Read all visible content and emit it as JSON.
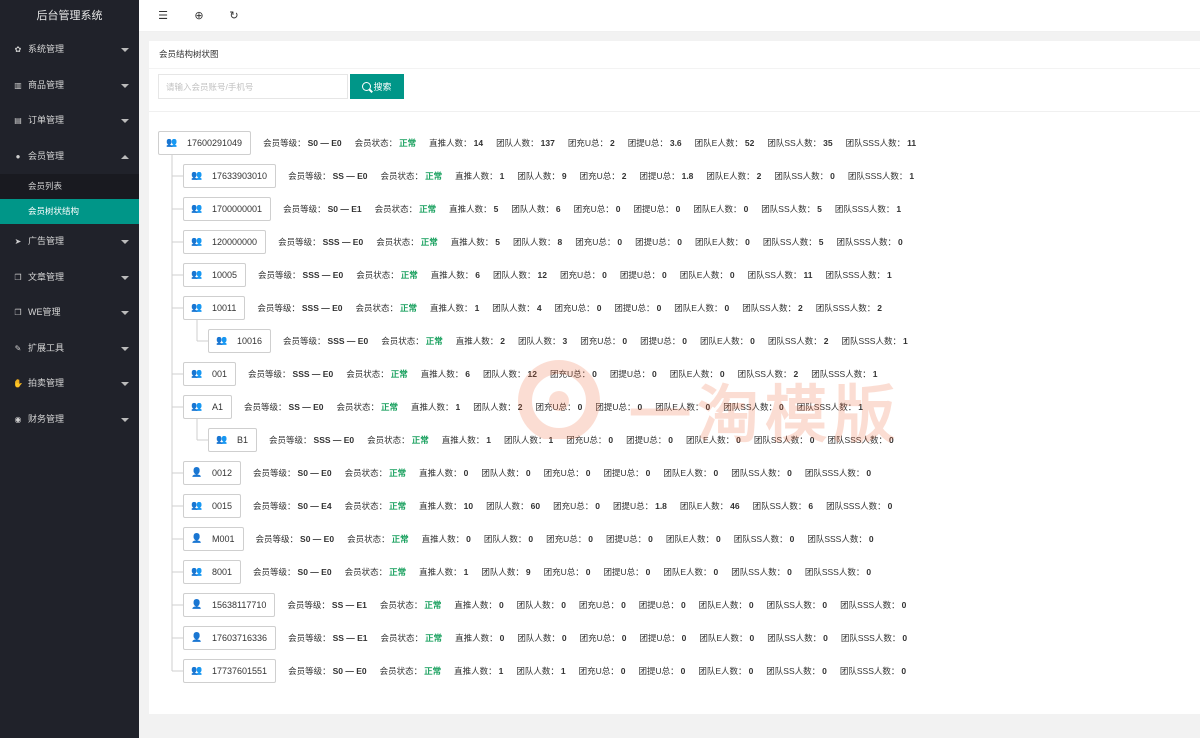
{
  "app": {
    "title": "后台管理系统"
  },
  "sidebar": {
    "items": [
      {
        "label": "系统管理",
        "icon": "gear-icon",
        "glyph": "✿",
        "expanded": false
      },
      {
        "label": "商品管理",
        "icon": "bar-chart-icon",
        "glyph": "▥",
        "expanded": false
      },
      {
        "label": "订单管理",
        "icon": "list-icon",
        "glyph": "▤",
        "expanded": false
      },
      {
        "label": "会员管理",
        "icon": "users-icon",
        "glyph": "●",
        "expanded": true,
        "children": [
          {
            "label": "会员列表",
            "active": false
          },
          {
            "label": "会员树状结构",
            "active": true
          }
        ]
      },
      {
        "label": "广告管理",
        "icon": "rocket-icon",
        "glyph": "➤",
        "expanded": false
      },
      {
        "label": "文章管理",
        "icon": "copy-icon",
        "glyph": "❐",
        "expanded": false
      },
      {
        "label": "WE管理",
        "icon": "copy-icon",
        "glyph": "❐",
        "expanded": false
      },
      {
        "label": "扩展工具",
        "icon": "wrench-icon",
        "glyph": "✎",
        "expanded": false
      },
      {
        "label": "拍卖管理",
        "icon": "hand-icon",
        "glyph": "✋",
        "expanded": false
      },
      {
        "label": "财务管理",
        "icon": "dashboard-icon",
        "glyph": "◉",
        "expanded": false
      }
    ]
  },
  "header": {
    "buttons": [
      {
        "name": "menu-toggle-icon",
        "glyph": "☰"
      },
      {
        "name": "globe-icon",
        "glyph": "⊕"
      },
      {
        "name": "refresh-icon",
        "glyph": "↻"
      }
    ]
  },
  "card": {
    "title": "会员结构树状图"
  },
  "search": {
    "placeholder": "请输入会员账号/手机号",
    "button_label": "搜索"
  },
  "labels": {
    "level": "会员等级：",
    "status": "会员状态：",
    "direct": "直推人数：",
    "team": "团队人数：",
    "recharge": "团充U总：",
    "withdraw": "团提U总：",
    "team_e": "团队E人数：",
    "team_ss": "团队SS人数：",
    "team_sss": "团队SSS人数："
  },
  "tree": [
    {
      "id": "17600291049",
      "depth": 0,
      "group": true,
      "level": "S0 — E0",
      "status": "正常",
      "direct": "14",
      "team": "137",
      "recharge": "2",
      "withdraw": "3.6",
      "team_e": "52",
      "team_ss": "35",
      "team_sss": "11"
    },
    {
      "id": "17633903010",
      "depth": 1,
      "group": true,
      "level": "SS — E0",
      "status": "正常",
      "direct": "1",
      "team": "9",
      "recharge": "2",
      "withdraw": "1.8",
      "team_e": "2",
      "team_ss": "0",
      "team_sss": "1"
    },
    {
      "id": "1700000001",
      "depth": 1,
      "group": true,
      "level": "S0 — E1",
      "status": "正常",
      "direct": "5",
      "team": "6",
      "recharge": "0",
      "withdraw": "0",
      "team_e": "0",
      "team_ss": "5",
      "team_sss": "1"
    },
    {
      "id": "120000000",
      "depth": 1,
      "group": true,
      "level": "SSS — E0",
      "status": "正常",
      "direct": "5",
      "team": "8",
      "recharge": "0",
      "withdraw": "0",
      "team_e": "0",
      "team_ss": "5",
      "team_sss": "0"
    },
    {
      "id": "10005",
      "depth": 1,
      "group": true,
      "level": "SSS — E0",
      "status": "正常",
      "direct": "6",
      "team": "12",
      "recharge": "0",
      "withdraw": "0",
      "team_e": "0",
      "team_ss": "11",
      "team_sss": "1"
    },
    {
      "id": "10011",
      "depth": 1,
      "group": true,
      "level": "SSS — E0",
      "status": "正常",
      "direct": "1",
      "team": "4",
      "recharge": "0",
      "withdraw": "0",
      "team_e": "0",
      "team_ss": "2",
      "team_sss": "2"
    },
    {
      "id": "10016",
      "depth": 2,
      "group": true,
      "level": "SSS — E0",
      "status": "正常",
      "direct": "2",
      "team": "3",
      "recharge": "0",
      "withdraw": "0",
      "team_e": "0",
      "team_ss": "2",
      "team_sss": "1"
    },
    {
      "id": "001",
      "depth": 1,
      "group": true,
      "level": "SSS — E0",
      "status": "正常",
      "direct": "6",
      "team": "12",
      "recharge": "0",
      "withdraw": "0",
      "team_e": "0",
      "team_ss": "2",
      "team_sss": "1"
    },
    {
      "id": "A1",
      "depth": 1,
      "group": true,
      "level": "SS — E0",
      "status": "正常",
      "direct": "1",
      "team": "2",
      "recharge": "0",
      "withdraw": "0",
      "team_e": "0",
      "team_ss": "0",
      "team_sss": "1"
    },
    {
      "id": "B1",
      "depth": 2,
      "group": true,
      "level": "SSS — E0",
      "status": "正常",
      "direct": "1",
      "team": "1",
      "recharge": "0",
      "withdraw": "0",
      "team_e": "0",
      "team_ss": "0",
      "team_sss": "0"
    },
    {
      "id": "0012",
      "depth": 1,
      "group": false,
      "level": "S0 — E0",
      "status": "正常",
      "direct": "0",
      "team": "0",
      "recharge": "0",
      "withdraw": "0",
      "team_e": "0",
      "team_ss": "0",
      "team_sss": "0"
    },
    {
      "id": "0015",
      "depth": 1,
      "group": true,
      "level": "S0 — E4",
      "status": "正常",
      "direct": "10",
      "team": "60",
      "recharge": "0",
      "withdraw": "1.8",
      "team_e": "46",
      "team_ss": "6",
      "team_sss": "0"
    },
    {
      "id": "M001",
      "depth": 1,
      "group": false,
      "level": "S0 — E0",
      "status": "正常",
      "direct": "0",
      "team": "0",
      "recharge": "0",
      "withdraw": "0",
      "team_e": "0",
      "team_ss": "0",
      "team_sss": "0"
    },
    {
      "id": "8001",
      "depth": 1,
      "group": true,
      "level": "S0 — E0",
      "status": "正常",
      "direct": "1",
      "team": "9",
      "recharge": "0",
      "withdraw": "0",
      "team_e": "0",
      "team_ss": "0",
      "team_sss": "0"
    },
    {
      "id": "15638117710",
      "depth": 1,
      "group": false,
      "level": "SS — E1",
      "status": "正常",
      "direct": "0",
      "team": "0",
      "recharge": "0",
      "withdraw": "0",
      "team_e": "0",
      "team_ss": "0",
      "team_sss": "0"
    },
    {
      "id": "17603716336",
      "depth": 1,
      "group": false,
      "level": "SS — E1",
      "status": "正常",
      "direct": "0",
      "team": "0",
      "recharge": "0",
      "withdraw": "0",
      "team_e": "0",
      "team_ss": "0",
      "team_sss": "0"
    },
    {
      "id": "17737601551",
      "depth": 1,
      "group": true,
      "level": "S0 — E0",
      "status": "正常",
      "direct": "1",
      "team": "1",
      "recharge": "0",
      "withdraw": "0",
      "team_e": "0",
      "team_ss": "0",
      "team_sss": "0"
    }
  ],
  "watermark": {
    "text": "一淘模版"
  },
  "colors": {
    "accent": "#009688",
    "sidebar": "#20222a",
    "status_green": "#17a05d",
    "icon_blue": "#1e9fff"
  }
}
